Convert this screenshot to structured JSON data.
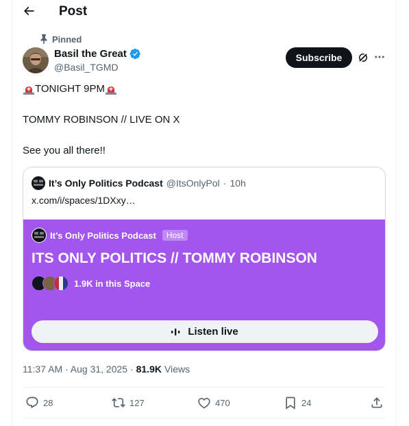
{
  "header": {
    "title": "Post",
    "back_icon": "arrow-left-icon"
  },
  "post": {
    "pinned_label": "Pinned",
    "author_name": "Basil the Great",
    "author_handle": "@Basil_TGMD",
    "verified": true,
    "subscribe_label": "Subscribe",
    "text_line1": "TONIGHT 9PM",
    "text_line2": "TOMMY ROBINSON // LIVE ON X",
    "text_line3": "See you all there!!",
    "emoji": "siren-emoji",
    "timestamp": "11:37 AM · Aug 31, 2025 ·",
    "views_count": "81.9K",
    "views_label": "Views"
  },
  "quote": {
    "name": "It’s Only Politics Podcast",
    "handle": "@ItsOnlyPol",
    "separator": "·",
    "time": "10h",
    "link": "x.com/i/spaces/1DXxy…",
    "space": {
      "host_name": "It’s Only Politics Podcast",
      "host_badge": "Host",
      "title": "ITS ONLY POLITICS // TOMMY ROBINSON",
      "listeners": "1.9K in this Space",
      "listen_label": "Listen live",
      "background_color": "#a256ed"
    }
  },
  "actions": {
    "replies": "28",
    "reposts": "127",
    "likes": "470",
    "bookmarks": "24"
  },
  "colors": {
    "accent": "#1d9bf0",
    "text_primary": "#0f1419",
    "text_secondary": "#536471",
    "space_purple": "#a256ed"
  }
}
